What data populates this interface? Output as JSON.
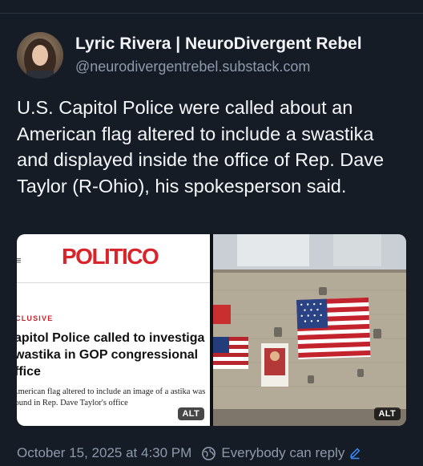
{
  "post": {
    "author": {
      "display_name": "Lyric Rivera | NeuroDivergent Rebel",
      "handle": "@neurodivergentrebel.substack.com"
    },
    "text": "U.S. Capitol Police were called about an American flag altered to include a swastika and displayed inside the office of Rep. Dave Taylor (R-Ohio), his spokesperson said.",
    "media": [
      {
        "kind": "screenshot",
        "brand": "POLITICO",
        "kicker": "CLUSIVE",
        "headline": "apitol Police called to investiga wastika in GOP congressional ffice",
        "dek": "American flag altered to include an image of a astika was found in Rep. Dave Taylor's office",
        "alt_label": "ALT"
      },
      {
        "kind": "photo",
        "alt_label": "ALT"
      }
    ],
    "timestamp": "October 15, 2025 at 4:30 PM",
    "reply_setting": "Everybody can reply"
  },
  "colors": {
    "background": "#151c26",
    "muted_text": "#8e9aab",
    "accent": "#3d8bfd",
    "politico_red": "#d8242b"
  },
  "icons": [
    "avatar",
    "globe-reply-icon",
    "pencil-edit-icon"
  ]
}
